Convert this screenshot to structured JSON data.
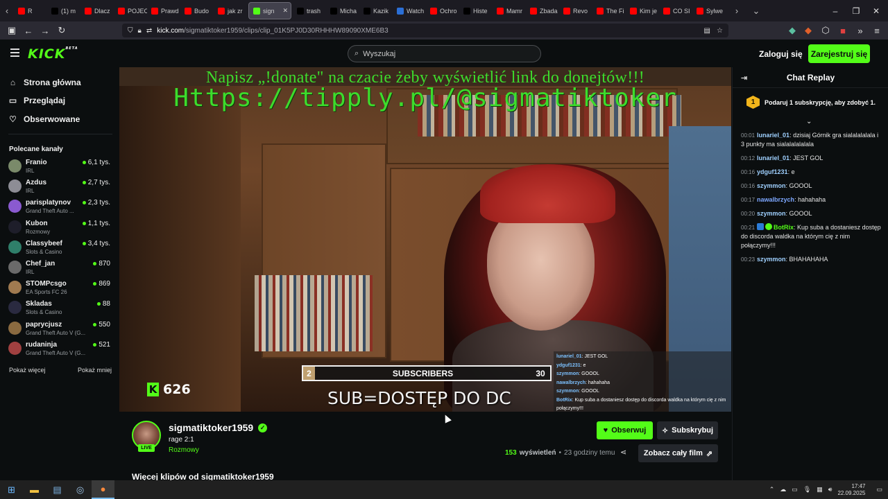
{
  "browser": {
    "tabs": [
      {
        "label": "R",
        "color": "#ff0000"
      },
      {
        "label": "(1) m",
        "color": "#000000"
      },
      {
        "label": "Dlacz",
        "color": "#ff0000"
      },
      {
        "label": "POJEC",
        "color": "#ff0000"
      },
      {
        "label": "Prawd",
        "color": "#ff0000"
      },
      {
        "label": "Budo",
        "color": "#ff0000"
      },
      {
        "label": "jak zr",
        "color": "#ff0000"
      },
      {
        "label": "sign",
        "color": "#53fc18"
      },
      {
        "label": "trash",
        "color": "#000000"
      },
      {
        "label": "Micha",
        "color": "#000000"
      },
      {
        "label": "Kazik",
        "color": "#000000"
      },
      {
        "label": "Watch",
        "color": "#2b6fd6"
      },
      {
        "label": "Ochro",
        "color": "#ff0000"
      },
      {
        "label": "Histe",
        "color": "#000000"
      },
      {
        "label": "Mamr",
        "color": "#ff0000"
      },
      {
        "label": "Zbada",
        "color": "#ff0000"
      },
      {
        "label": "Revo",
        "color": "#ff0000"
      },
      {
        "label": "The Fi",
        "color": "#ff0000"
      },
      {
        "label": "Kim je",
        "color": "#ff0000"
      },
      {
        "label": "CO SI",
        "color": "#ff0000"
      },
      {
        "label": "Sylwe",
        "color": "#ff0000"
      }
    ],
    "url_host": "kick.com",
    "url_path": "/sigmatiktoker1959/clips/clip_01K5PJ0D30RHHHW89090XME6B3"
  },
  "header": {
    "logo": "KICK",
    "logo_sup": "BETA",
    "search_placeholder": "Wyszukaj",
    "login": "Zaloguj się",
    "register": "Zarejestruj się"
  },
  "sidebar": {
    "nav": [
      {
        "label": "Strona główna",
        "icon": "home-icon"
      },
      {
        "label": "Przeglądaj",
        "icon": "browse-icon"
      },
      {
        "label": "Obserwowane",
        "icon": "heart-icon"
      }
    ],
    "recommended_title": "Polecane kanały",
    "channels": [
      {
        "name": "Franio",
        "category": "IRL",
        "viewers": "6,1 tys.",
        "color": "#7a8a6a"
      },
      {
        "name": "Azdus",
        "category": "IRL",
        "viewers": "2,7 tys.",
        "color": "#8d8d95"
      },
      {
        "name": "parisplatynov",
        "category": "Grand Theft Auto ...",
        "viewers": "2,3 tys.",
        "color": "#8a5ad0"
      },
      {
        "name": "Kubon",
        "category": "Rozmowy",
        "viewers": "1,1 tys.",
        "color": "#1e1e2a"
      },
      {
        "name": "Classybeef",
        "category": "Slots & Casino",
        "viewers": "3,4 tys.",
        "color": "#2f7f6a"
      },
      {
        "name": "Chef_jan",
        "category": "IRL",
        "viewers": "870",
        "color": "#6a6a6a"
      },
      {
        "name": "STOMPcsgo",
        "category": "EA Sports FC 26",
        "viewers": "869",
        "color": "#a07a50"
      },
      {
        "name": "Skladas",
        "category": "Slots & Casino",
        "viewers": "88",
        "color": "#2a2a40"
      },
      {
        "name": "paprycjusz",
        "category": "Grand Theft Auto V (G...",
        "viewers": "550",
        "color": "#8a6a40"
      },
      {
        "name": "rudaninja",
        "category": "Grand Theft Auto V (G...",
        "viewers": "521",
        "color": "#a04040"
      }
    ],
    "show_more": "Pokaż więcej",
    "show_less": "Pokaż mniej"
  },
  "video": {
    "overlay_title": "Napisz „!donate\" na czacie żeby wyświetlić link do donejtów!!!",
    "overlay_link": "Https://tipply.pl/@sigmatiktoker",
    "kick_counter": "626",
    "subs_current": "2",
    "subs_label": "SUBSCRIBERS",
    "subs_goal": "30",
    "sub_text": "SUB=DOSTĘP DO DC",
    "overlay_chat": [
      {
        "user": "lunariel_01",
        "text": ": JEST GOL"
      },
      {
        "user": "ydguf1231",
        "text": ": e"
      },
      {
        "user": "szymmon",
        "text": ": GOOOL"
      },
      {
        "user": "nawalbrzych",
        "text": ": hahahaha"
      },
      {
        "user": "szymmon",
        "text": ": GOOOL"
      },
      {
        "user": "BotRix",
        "text": ": Kup suba a dostaniesz dostęp do discorda waldka na którym cię z nim połączymy!!!"
      }
    ]
  },
  "streamer": {
    "name": "sigmatiktoker1959",
    "live": "LIVE",
    "title": "rage 2:1",
    "category": "Rozmowy",
    "follow": "Obserwuj",
    "subscribe": "Subskrybuj",
    "views_count": "153",
    "views_label": "wyświetleń",
    "time_ago": "23 godziny temu",
    "full_video": "Zobacz cały film",
    "more_clips": "Więcej klipów od sigmatiktoker1959"
  },
  "chat": {
    "title": "Chat Replay",
    "pinned_badge": "1",
    "pinned_text": "Podaruj 1 subskrypcję, aby zdobyć 1.",
    "messages": [
      {
        "time": "00:01",
        "user": "lunariel_01",
        "color": "#9fd0ff",
        "text": ": dzisiaj Górnik gra sialalalalala i 3 punkty ma sialalalalalala"
      },
      {
        "time": "00:12",
        "user": "lunariel_01",
        "color": "#9fd0ff",
        "text": ": JEST GOL"
      },
      {
        "time": "00:16",
        "user": "ydguf1231",
        "color": "#9fd0ff",
        "text": ": e"
      },
      {
        "time": "00:16",
        "user": "szymmon",
        "color": "#9fd0ff",
        "text": ": GOOOL"
      },
      {
        "time": "00:17",
        "user": "nawalbrzych",
        "color": "#7da7ff",
        "text": ": hahahaha"
      },
      {
        "time": "00:20",
        "user": "szymmon",
        "color": "#9fd0ff",
        "text": ": GOOOL"
      },
      {
        "time": "00:21",
        "user": "BotRix",
        "color": "#53fc18",
        "text": ": Kup suba a dostaniesz dostęp do discorda waldka na którym cię z nim połączymy!!!"
      },
      {
        "time": "00:23",
        "user": "szymmon",
        "color": "#9fd0ff",
        "text": ": BHAHAHAHA"
      }
    ]
  },
  "taskbar": {
    "time": "17:47",
    "date": "22.09.2025"
  }
}
